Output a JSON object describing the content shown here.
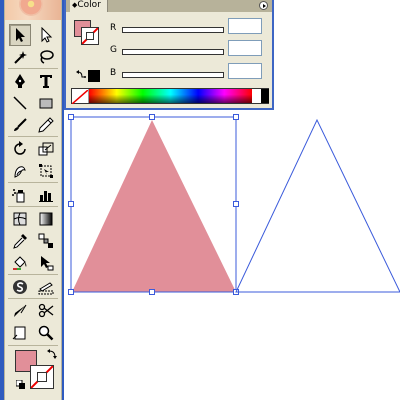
{
  "color_panel": {
    "tab_label": "Color",
    "channels": [
      {
        "label": "R",
        "value": ""
      },
      {
        "label": "G",
        "value": ""
      },
      {
        "label": "B",
        "value": ""
      }
    ],
    "fill_color": "#e18f99",
    "last_color": "#000000"
  },
  "toolbox": {
    "fill_color": "#e18f99",
    "tools": [
      "selection-tool",
      "direct-selection-tool",
      "magic-wand-tool",
      "lasso-tool",
      "pen-tool",
      "type-tool",
      "line-segment-tool",
      "rectangle-tool",
      "paintbrush-tool",
      "pencil-tool",
      "rotate-tool",
      "scale-tool",
      "warp-tool",
      "free-transform-tool",
      "symbol-sprayer-tool",
      "column-graph-tool",
      "mesh-tool",
      "gradient-tool",
      "eyedropper-tool",
      "blend-tool",
      "live-paint-bucket-tool",
      "live-paint-selection-tool",
      "symbol-tool",
      "slice-tool",
      "scissors-tool",
      "scissors-tool-alt",
      "page-tool",
      "zoom-tool"
    ],
    "active_tool": "selection-tool"
  },
  "artwork": {
    "selected_triangle_fill": "#e18f99",
    "selection_color": "#3b5bdb",
    "outline_triangle_stroke": "#3b5bdb"
  }
}
